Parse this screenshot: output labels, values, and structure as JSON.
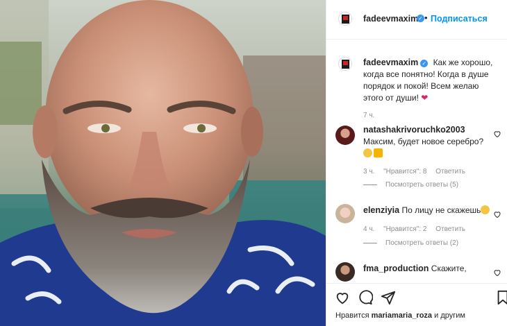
{
  "post": {
    "author": "fadeevmaxim",
    "follow_label": "Подписаться",
    "dot": "•",
    "caption": "Как же хорошо, когда все понятно! Когда в душе порядок и покой! Всем желаю этого от души!",
    "time": "7 ч."
  },
  "comments": [
    {
      "username": "natashakrivoruchko2003",
      "text": "Максим, будет новое серебро?",
      "time": "3 ч.",
      "likes": "\"Нравится\": 8",
      "reply": "Ответить",
      "replies": "Посмотреть ответы (5)"
    },
    {
      "username": "elenziyia",
      "text": "По лицу не скажешь",
      "time": "4 ч.",
      "likes": "\"Нравится\": 2",
      "reply": "Ответить",
      "replies": "Посмотреть ответы (2)"
    },
    {
      "username": "fma_production",
      "text": "Скажите,"
    }
  ],
  "likes_bar": {
    "prefix": "Нравится",
    "user": "mariamaria_roza",
    "suffix": "и другим"
  },
  "icons": [
    "heart-icon",
    "comment-icon",
    "share-icon",
    "bookmark-icon",
    "verified-badge-icon"
  ],
  "colors": {
    "link": "#0095f6",
    "verified": "#3897f0",
    "meta": "#8e8e8e"
  }
}
